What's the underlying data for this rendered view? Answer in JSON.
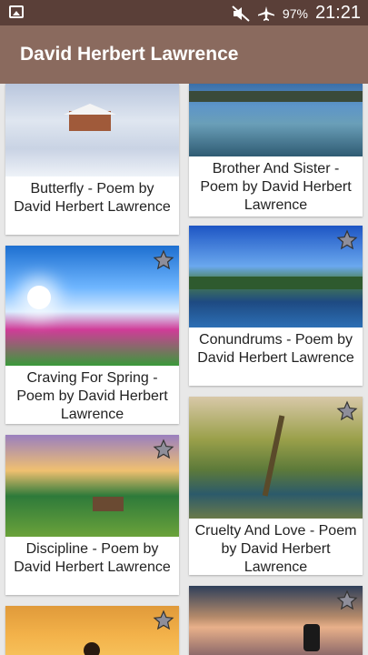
{
  "status_bar": {
    "battery": "97%",
    "time": "21:21"
  },
  "app_bar": {
    "title": "David Herbert Lawrence"
  },
  "cards": [
    {
      "caption": "Butterfly - Poem by David Herbert Lawrence"
    },
    {
      "caption": "Brother And Sister - Poem by David Herbert Lawrence"
    },
    {
      "caption": "Craving For Spring - Poem by David Herbert Lawrence"
    },
    {
      "caption": "Conundrums - Poem by David Herbert Lawrence"
    },
    {
      "caption": "Discipline - Poem by David Herbert Lawrence"
    },
    {
      "caption": "Cruelty And Love - Poem by David Herbert Lawrence"
    },
    {
      "caption": ""
    },
    {
      "caption": ""
    }
  ],
  "icons": {
    "gallery": "image-icon",
    "mute": "mute-icon",
    "airplane": "airplane-mode-icon",
    "favorite": "star-icon"
  }
}
